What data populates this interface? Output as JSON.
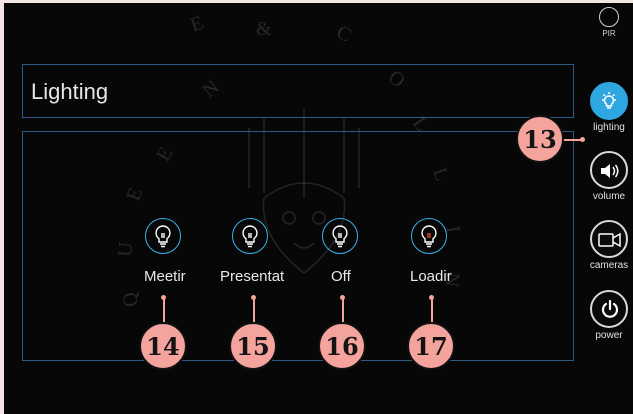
{
  "panel": {
    "title": "Lighting"
  },
  "modes": [
    {
      "label": "Meetir",
      "icon": "lightbulb-icon"
    },
    {
      "label": "Presentat",
      "icon": "lightbulb-icon"
    },
    {
      "label": "Off",
      "icon": "lightbulb-icon"
    },
    {
      "label": "Loadir",
      "icon": "lightbulb-icon"
    }
  ],
  "sidebar": {
    "pir": "PIR",
    "items": [
      {
        "label": "lighting",
        "icon": "lightbulb-icon",
        "active": true
      },
      {
        "label": "volume",
        "icon": "speaker-icon",
        "active": false
      },
      {
        "label": "cameras",
        "icon": "camera-icon",
        "active": false
      },
      {
        "label": "power",
        "icon": "power-icon",
        "active": false
      }
    ]
  },
  "callouts": [
    "13",
    "14",
    "15",
    "16",
    "17"
  ],
  "colors": {
    "accent": "#2ea7e0",
    "panel_border": "#2d5a82",
    "callout": "#f4a49d",
    "background": "#070708"
  }
}
